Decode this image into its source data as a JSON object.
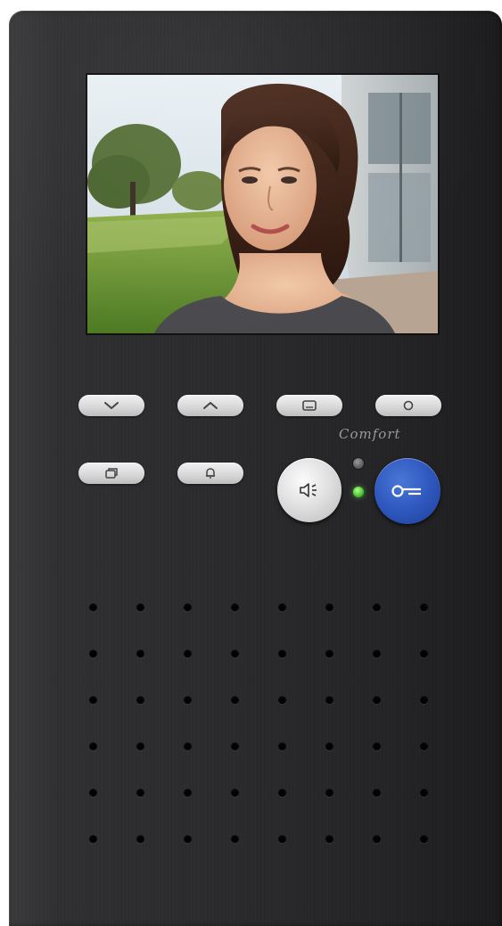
{
  "device": {
    "brand_text": "Comfort",
    "icons": {
      "down": "chevron-down-icon",
      "up": "chevron-up-icon",
      "message": "message-icon",
      "power": "circle-icon",
      "pages": "pages-icon",
      "bell": "bell-icon",
      "speaker": "speaker-icon",
      "key": "key-icon"
    },
    "colors": {
      "body": "#2a2a2c",
      "button": "#d9d9d9",
      "key_button": "#2f58bf",
      "led_green": "#4fc83a",
      "led_gray": "#6e6e6e"
    },
    "grille": {
      "rows": 6,
      "cols": 8
    }
  }
}
